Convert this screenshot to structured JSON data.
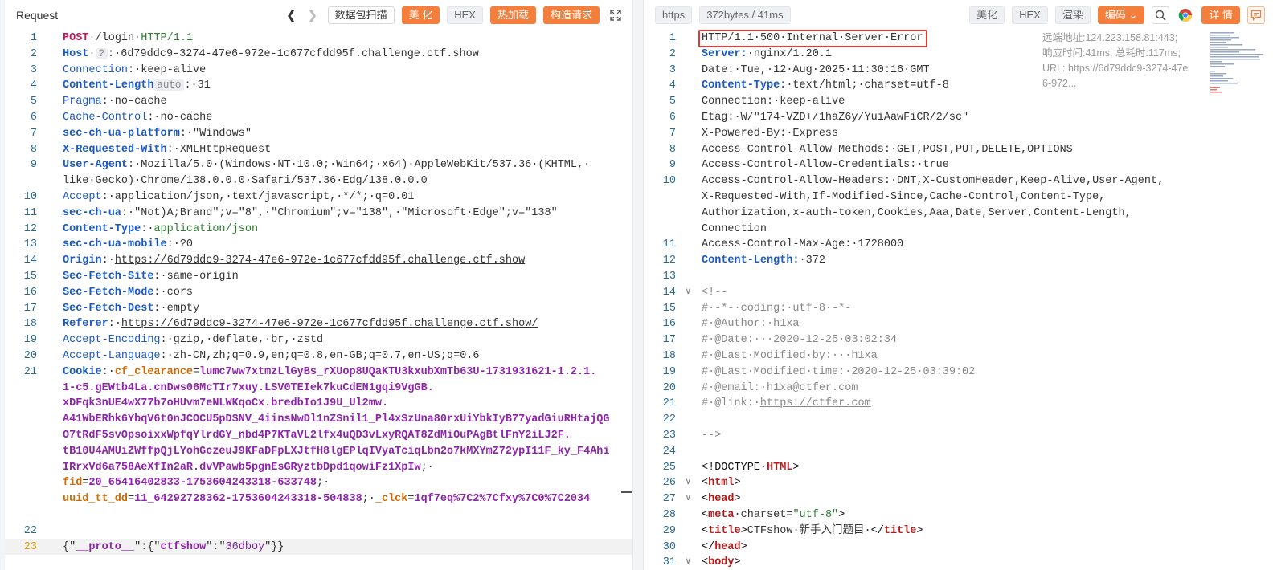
{
  "left": {
    "title": "Request",
    "buttons": {
      "scan": "数据包扫描",
      "beautify": "美 化",
      "hex": "HEX",
      "hot": "热加载",
      "build": "构造请求"
    },
    "lines": [
      {
        "n": "1",
        "segs": [
          [
            "m",
            "POST"
          ],
          [
            "dot",
            "·"
          ],
          [
            "v",
            "/login"
          ],
          [
            "dot",
            "·"
          ],
          [
            "gr",
            "HTTP/1.1"
          ]
        ]
      },
      {
        "n": "2",
        "segs": [
          [
            "k",
            "Host"
          ],
          [
            "dot",
            "·"
          ],
          [
            "badge",
            "?"
          ],
          [
            "v",
            ":·6d79ddc9-3274-47e6-972e-1c677cfdd95f.challenge.ctf.show"
          ]
        ]
      },
      {
        "n": "3",
        "segs": [
          [
            "kn",
            "Connection"
          ],
          [
            "v",
            ":·keep-alive"
          ]
        ]
      },
      {
        "n": "4",
        "segs": [
          [
            "k",
            "Content-Length"
          ],
          [
            "badge",
            "auto"
          ],
          [
            "v",
            ":·31"
          ]
        ]
      },
      {
        "n": "5",
        "segs": [
          [
            "kn",
            "Pragma"
          ],
          [
            "v",
            ":·no-cache"
          ]
        ]
      },
      {
        "n": "6",
        "segs": [
          [
            "kn",
            "Cache-Control"
          ],
          [
            "v",
            ":·no-cache"
          ]
        ]
      },
      {
        "n": "7",
        "segs": [
          [
            "k",
            "sec-ch-ua-platform"
          ],
          [
            "v",
            ":·\"Windows\""
          ]
        ]
      },
      {
        "n": "8",
        "segs": [
          [
            "k",
            "X-Requested-With"
          ],
          [
            "v",
            ":·XMLHttpRequest"
          ]
        ]
      },
      {
        "n": "9",
        "segs": [
          [
            "k",
            "User-Agent"
          ],
          [
            "v",
            ":·Mozilla/5.0·(Windows·NT·10.0;·Win64;·x64)·AppleWebKit/537.36·(KHTML,·"
          ]
        ]
      },
      {
        "n": "",
        "segs": [
          [
            "v",
            "like·Gecko)·Chrome/138.0.0.0·Safari/537.36·Edg/138.0.0.0"
          ]
        ]
      },
      {
        "n": "10",
        "segs": [
          [
            "kn",
            "Accept"
          ],
          [
            "v",
            ":·application/json,·text/javascript,·*/*;·q=0.01"
          ]
        ]
      },
      {
        "n": "11",
        "segs": [
          [
            "k",
            "sec-ch-ua"
          ],
          [
            "v",
            ":·\"Not)A;Brand\";v=\"8\",·\"Chromium\";v=\"138\",·\"Microsoft·Edge\";v=\"138\""
          ]
        ]
      },
      {
        "n": "12",
        "segs": [
          [
            "k",
            "Content-Type"
          ],
          [
            "v",
            ":·"
          ],
          [
            "gr",
            "application/json"
          ]
        ]
      },
      {
        "n": "13",
        "segs": [
          [
            "k",
            "sec-ch-ua-mobile"
          ],
          [
            "v",
            ":·?0"
          ]
        ]
      },
      {
        "n": "14",
        "segs": [
          [
            "k",
            "Origin"
          ],
          [
            "v",
            ":·"
          ],
          [
            "u",
            "https://6d79ddc9-3274-47e6-972e-1c677cfdd95f.challenge.ctf.show"
          ]
        ]
      },
      {
        "n": "15",
        "segs": [
          [
            "k",
            "Sec-Fetch-Site"
          ],
          [
            "v",
            ":·same-origin"
          ]
        ]
      },
      {
        "n": "16",
        "segs": [
          [
            "k",
            "Sec-Fetch-Mode"
          ],
          [
            "v",
            ":·cors"
          ]
        ]
      },
      {
        "n": "17",
        "segs": [
          [
            "k",
            "Sec-Fetch-Dest"
          ],
          [
            "v",
            ":·empty"
          ]
        ]
      },
      {
        "n": "18",
        "segs": [
          [
            "k",
            "Referer"
          ],
          [
            "v",
            ":·"
          ],
          [
            "u",
            "https://6d79ddc9-3274-47e6-972e-1c677cfdd95f.challenge.ctf.show/"
          ]
        ]
      },
      {
        "n": "19",
        "segs": [
          [
            "kn",
            "Accept-Encoding"
          ],
          [
            "v",
            ":·gzip,·deflate,·br,·zstd"
          ]
        ]
      },
      {
        "n": "20",
        "segs": [
          [
            "kn",
            "Accept-Language"
          ],
          [
            "v",
            ":·zh-CN,zh;q=0.9,en;q=0.8,en-GB;q=0.7,en-US;q=0.6"
          ]
        ]
      },
      {
        "n": "21",
        "segs": [
          [
            "k",
            "Cookie"
          ],
          [
            "v",
            ":·"
          ],
          [
            "org",
            "cf_clearance"
          ],
          [
            "v",
            "="
          ],
          [
            "pk",
            "lumc7ww7xtmzLlGyBs_rXUop8UQaKTU3kxubXmTb63U-1731931621-1.2.1."
          ]
        ]
      },
      {
        "n": "",
        "segs": [
          [
            "pk",
            "1-c5.gEWtb4La.cnDws06McTIr7xuy.LSV0TEIek7kuCdEN1gqi9VgGB."
          ]
        ]
      },
      {
        "n": "",
        "segs": [
          [
            "pk",
            "xDFqk3nUE4wX77b7oHUvm7eNLWKqoCx.bredbIo1J9U_Ul2mw."
          ]
        ]
      },
      {
        "n": "",
        "segs": [
          [
            "pk",
            "A41WbERhk6YbqV6t0nJCOCU5pDSNV_4iinsNwDl1nZSnil1_Pl4xSzUna80rxUiYbkIyB77yadGiuRHtajQG"
          ]
        ]
      },
      {
        "n": "",
        "segs": [
          [
            "pk",
            "O7tRdF5svOpsoixxWpfqYlrdGY_nbd4P7KTaVL2lfx4uQD3vLxyRQAT8ZdMiOuPAgBtlFnY2iLJ2F."
          ]
        ]
      },
      {
        "n": "",
        "segs": [
          [
            "pk",
            "tB10U4AMUiZWffpQjLYohGczeuJ9KFaDFpLXJtfH8lgEPlqIVyaTciqLbn2o7kMXYmZ72ypI11F_ky_F4Ahi"
          ]
        ]
      },
      {
        "n": "",
        "segs": [
          [
            "pk",
            "IRrxVd6a758AeXfIn2aR.dvVPawb5pgnEsGRyztbDpd1qowiFz1XpIw"
          ],
          [
            "v",
            ";·"
          ]
        ]
      },
      {
        "n": "",
        "segs": [
          [
            "org",
            "fid"
          ],
          [
            "v",
            "="
          ],
          [
            "pk",
            "20_65416402833-1753604243318-633748"
          ],
          [
            "v",
            ";·"
          ]
        ]
      },
      {
        "n": "",
        "segs": [
          [
            "org",
            "uuid_tt_dd"
          ],
          [
            "v",
            "="
          ],
          [
            "pk",
            "11_64292728362-1753604243318-504838"
          ],
          [
            "v",
            ";·"
          ],
          [
            "org",
            "_clck"
          ],
          [
            "v",
            "="
          ],
          [
            "pk",
            "1qf7eq%7C2%7Cfxy%7C0%7C2034"
          ]
        ]
      },
      {
        "n": "",
        "segs": []
      },
      {
        "n": "22",
        "segs": []
      },
      {
        "n": "23",
        "cur": true,
        "segs": [
          [
            "v",
            "{\""
          ],
          [
            "pk",
            "__proto__"
          ],
          [
            "v",
            "\":{\""
          ],
          [
            "pk",
            "ctfshow"
          ],
          [
            "v",
            "\":\""
          ],
          [
            "pv",
            "36dboy"
          ],
          [
            "v",
            "\"}}"
          ]
        ]
      }
    ]
  },
  "right": {
    "badges": {
      "protocol": "https",
      "size": "372bytes / 41ms"
    },
    "buttons": {
      "beautify": "美化",
      "hex": "HEX",
      "render": "渲染",
      "encode": "编码",
      "detail": "详 情"
    },
    "remote_info": "远端地址:124.223.158.81:443; 响应时间:41ms; 总耗时:117ms; URL: https://6d79ddc9-3274-47e6-972...",
    "lines": [
      {
        "n": "1",
        "segs": [
          [
            "v",
            "HTTP/1.1·500·Internal·Server·Error"
          ]
        ]
      },
      {
        "n": "2",
        "segs": [
          [
            "k",
            "Server:"
          ],
          [
            "v",
            "·nginx/1.20.1"
          ]
        ]
      },
      {
        "n": "3",
        "segs": [
          [
            "v",
            "Date:·Tue,·12·Aug·2025·11:30:16·GMT"
          ]
        ]
      },
      {
        "n": "4",
        "segs": [
          [
            "k",
            "Content-Type:"
          ],
          [
            "v",
            "·text/html;·charset=utf-8"
          ]
        ]
      },
      {
        "n": "5",
        "segs": [
          [
            "v",
            "Connection:·keep-alive"
          ]
        ]
      },
      {
        "n": "6",
        "segs": [
          [
            "v",
            "Etag:·W/\"174-VZD+/1haZ6y/YuiAawFiCR/2/sc\""
          ]
        ]
      },
      {
        "n": "7",
        "segs": [
          [
            "v",
            "X-Powered-By:·Express"
          ]
        ]
      },
      {
        "n": "8",
        "segs": [
          [
            "v",
            "Access-Control-Allow-Methods:·GET,POST,PUT,DELETE,OPTIONS"
          ]
        ]
      },
      {
        "n": "9",
        "segs": [
          [
            "v",
            "Access-Control-Allow-Credentials:·true"
          ]
        ]
      },
      {
        "n": "10",
        "segs": [
          [
            "v",
            "Access-Control-Allow-Headers:·DNT,X-CustomHeader,Keep-Alive,User-Agent,"
          ]
        ]
      },
      {
        "n": "",
        "segs": [
          [
            "v",
            "X-Requested-With,If-Modified-Since,Cache-Control,Content-Type,"
          ]
        ]
      },
      {
        "n": "",
        "segs": [
          [
            "v",
            "Authorization,x-auth-token,Cookies,Aaa,Date,Server,Content-Length,"
          ]
        ]
      },
      {
        "n": "",
        "segs": [
          [
            "v",
            "Connection"
          ]
        ]
      },
      {
        "n": "11",
        "segs": [
          [
            "v",
            "Access-Control-Max-Age:·1728000"
          ]
        ]
      },
      {
        "n": "12",
        "segs": [
          [
            "k",
            "Content-Length:"
          ],
          [
            "v",
            "·372"
          ]
        ]
      },
      {
        "n": "13",
        "segs": []
      },
      {
        "n": "14",
        "fold": true,
        "segs": [
          [
            "cm",
            "<!--"
          ]
        ]
      },
      {
        "n": "15",
        "segs": [
          [
            "cm",
            "#·-*-·coding:·utf-8·-*-"
          ]
        ]
      },
      {
        "n": "16",
        "segs": [
          [
            "cm",
            "#·@Author:·h1xa"
          ]
        ]
      },
      {
        "n": "17",
        "segs": [
          [
            "cm",
            "#·@Date:···2020-12-25·03:02:34"
          ]
        ]
      },
      {
        "n": "18",
        "segs": [
          [
            "cm",
            "#·@Last·Modified·by:···h1xa"
          ]
        ]
      },
      {
        "n": "19",
        "segs": [
          [
            "cm",
            "#·@Last·Modified·time:·2020-12-25·03:39:02"
          ]
        ]
      },
      {
        "n": "20",
        "segs": [
          [
            "cm",
            "#·@email:·h1xa@ctfer.com"
          ]
        ]
      },
      {
        "n": "21",
        "segs": [
          [
            "cm",
            "#·@link:·"
          ],
          [
            "cmu",
            "https://ctfer.com"
          ]
        ]
      },
      {
        "n": "22",
        "segs": []
      },
      {
        "n": "23",
        "segs": [
          [
            "cm",
            "-->"
          ]
        ]
      },
      {
        "n": "24",
        "segs": []
      },
      {
        "n": "25",
        "segs": [
          [
            "tag",
            "<!DOCTYPE·"
          ],
          [
            "tagn",
            "HTML"
          ],
          [
            "tag",
            ">"
          ]
        ]
      },
      {
        "n": "26",
        "fold": true,
        "segs": [
          [
            "tag",
            "<"
          ],
          [
            "tagn",
            "html"
          ],
          [
            "tag",
            ">"
          ]
        ]
      },
      {
        "n": "27",
        "fold": true,
        "segs": [
          [
            "tag",
            "<"
          ],
          [
            "tagn",
            "head"
          ],
          [
            "tag",
            ">"
          ]
        ]
      },
      {
        "n": "28",
        "segs": [
          [
            "tag",
            "<"
          ],
          [
            "tagn",
            "meta"
          ],
          [
            "attr",
            "·charset="
          ],
          [
            "str",
            "\"utf-8\""
          ],
          [
            "tag",
            ">"
          ]
        ]
      },
      {
        "n": "29",
        "segs": [
          [
            "tag",
            "<"
          ],
          [
            "tagn",
            "title"
          ],
          [
            "tag",
            ">"
          ],
          [
            "v",
            "CTFshow·新手入门题目·"
          ],
          [
            "tag",
            "</"
          ],
          [
            "tagn",
            "title"
          ],
          [
            "tag",
            ">"
          ]
        ]
      },
      {
        "n": "30",
        "segs": [
          [
            "tag",
            "</"
          ],
          [
            "tagn",
            "head"
          ],
          [
            "tag",
            ">"
          ]
        ]
      },
      {
        "n": "31",
        "fold": true,
        "segs": [
          [
            "tag",
            "<"
          ],
          [
            "tagn",
            "body"
          ],
          [
            "tag",
            ">"
          ]
        ]
      }
    ]
  }
}
